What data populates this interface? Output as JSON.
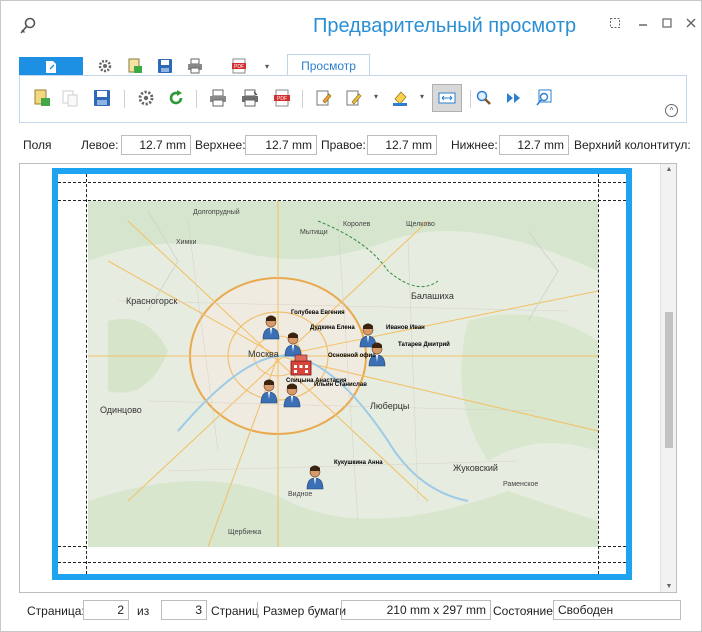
{
  "window": {
    "title": "Предварительный просмотр"
  },
  "tabs": {
    "preview_label": "Просмотр"
  },
  "margins": {
    "fields_label": "Поля",
    "left_label": "Левое:",
    "left_value": "12.7 mm",
    "top_label": "Верхнее:",
    "top_value": "12.7 mm",
    "right_label": "Правое:",
    "right_value": "12.7 mm",
    "bottom_label": "Нижнее:",
    "bottom_value": "12.7 mm",
    "header_label": "Верхний колонтитул:"
  },
  "map": {
    "places": [
      {
        "name": "Долгопрудный"
      },
      {
        "name": "Мытищи"
      },
      {
        "name": "Королев"
      },
      {
        "name": "Щелково"
      },
      {
        "name": "Химки"
      },
      {
        "name": "Красногорск"
      },
      {
        "name": "Балашиха"
      },
      {
        "name": "Москва"
      },
      {
        "name": "Одинцово"
      },
      {
        "name": "Люберцы"
      },
      {
        "name": "Жуковский"
      },
      {
        "name": "Видное"
      },
      {
        "name": "Раменское"
      },
      {
        "name": "Щербинка"
      }
    ],
    "people": [
      {
        "name": "Голубева Евгения"
      },
      {
        "name": "Дудкина Елена"
      },
      {
        "name": "Иванов Иван"
      },
      {
        "name": "Основной офис"
      },
      {
        "name": "Татарев Дмитрий"
      },
      {
        "name": "Спицына Анастасия"
      },
      {
        "name": "Ильин Станислав"
      },
      {
        "name": "Кукушкина Анна"
      }
    ]
  },
  "status": {
    "page_label": "Страница:",
    "page_current": "2",
    "of_label": "из",
    "page_total": "3",
    "pages_label": "Страниц",
    "paper_label": "Размер бумаги",
    "paper_value": "210 mm x 297 mm",
    "state_label": "Состояние",
    "state_value": "Свободен"
  },
  "colors": {
    "accent": "#2b8fd6",
    "page_border": "#1ea3f0",
    "file_tab": "#1e90e4"
  }
}
